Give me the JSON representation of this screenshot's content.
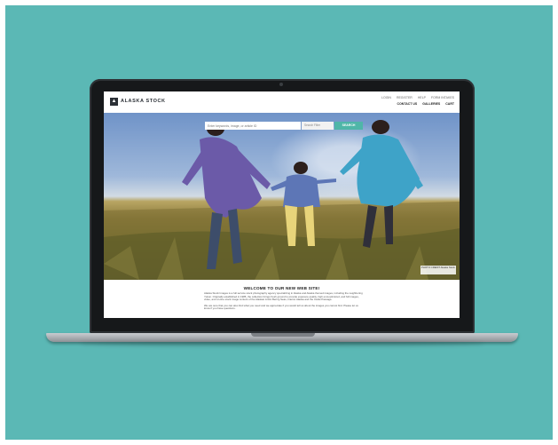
{
  "site": {
    "logo_text": "ALASKA STOCK",
    "nav_top": [
      "LOGIN",
      "REGISTER",
      "HELP",
      "FORM INTAKES"
    ],
    "nav_bottom": [
      "CONTACT US",
      "GALLERIES",
      "CART"
    ]
  },
  "hero": {
    "search_placeholder": "Enter keywords, image, or article ID",
    "search_filter": "Search Filter",
    "search_button": "SEARCH",
    "credit": "PHOTO CREDIT Alaska Stock"
  },
  "welcome": {
    "title": "WELCOME TO OUR NEW WEB SITE!",
    "paragraph_1": "Alaska Stock Images is a full service stock photography agency specializing in Alaska and Alaska themed images, including the neighboring Yukon. Originally established in 1985, the collection brings fresh ground to provide exposure quality, high end-optimized, and full images, video, and on-line stock image content of the Alaskan Arctic Bering Seas, Interior Alaska and the Inside Passage.",
    "paragraph_2": "We are sure that you can also find what you need and we appreciate if you would tell us about the images you cannot find. Please let us know if you have questions."
  },
  "colors": {
    "backdrop": "#5bb8b5",
    "accent": "#4fb6a8"
  }
}
